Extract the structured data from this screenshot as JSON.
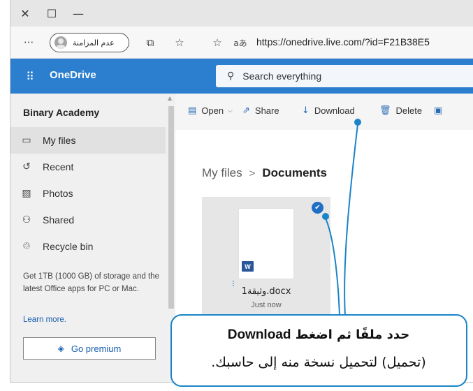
{
  "browser": {
    "close_glyph": "✕",
    "maximize_glyph": "☐",
    "minimize_glyph": "—",
    "more_glyph": "···",
    "profile_name": "عدم المزامنة",
    "collections_glyph": "⧉",
    "favorites_glyph": "☆",
    "readaloud_glyph": "☆",
    "readaloud_text": "aあ",
    "url": "https://onedrive.live.com/?id=F21B38E5"
  },
  "suite": {
    "waffle_glyph": "⠿",
    "brand": "OneDrive",
    "search_glyph": "⚲",
    "search_placeholder": "Search everything"
  },
  "nav": {
    "tenant": "Binary Academy",
    "items": [
      {
        "icon": "▭",
        "label": "My files"
      },
      {
        "icon": "↺",
        "label": "Recent"
      },
      {
        "icon": "▨",
        "label": "Photos"
      },
      {
        "icon": "⚇",
        "label": "Shared"
      },
      {
        "icon": "♲",
        "label": "Recycle bin"
      }
    ],
    "promo": "Get 1TB (1000 GB) of storage and the latest Office apps for PC or Mac.",
    "learn_more": "Learn more.",
    "premium_glyph": "◈",
    "premium_label": "Go premium"
  },
  "commands": {
    "open_glyph": "▤",
    "open": "Open",
    "open_chevron": "⌵",
    "share_glyph": "⇗",
    "share": "Share",
    "download_glyph": "↓",
    "download": "Download",
    "delete_glyph": "🗑",
    "delete": "Delete",
    "more_glyph": "▣"
  },
  "breadcrumb": {
    "root": "My files",
    "separator": ">",
    "current": "Documents"
  },
  "file": {
    "name": "وثيقة1.docx",
    "meta": "Just now",
    "type_badge": "W",
    "check_glyph": "✔",
    "spark_glyph": "⁝"
  },
  "callout": {
    "line1_prefix": "حدد ملفًا ثم اضغط ",
    "line1_keyword": "Download",
    "line2": "(تحميل) لتحميل نسخة منه إلى حاسبك."
  },
  "colors": {
    "suite": "#2c7fcf",
    "accent": "#1a84c7"
  }
}
